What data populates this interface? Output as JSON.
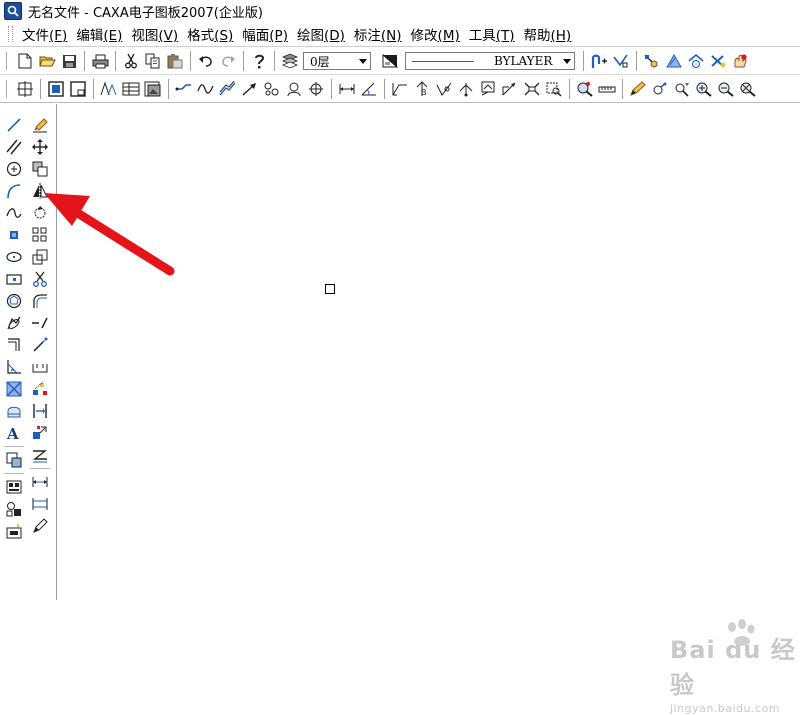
{
  "window": {
    "title": "无名文件 - CAXA电子图板2007(企业版)"
  },
  "menu": [
    {
      "label": "文件",
      "accel": "(F)"
    },
    {
      "label": "编辑",
      "accel": "(E)"
    },
    {
      "label": "视图",
      "accel": "(V)"
    },
    {
      "label": "格式",
      "accel": "(S)"
    },
    {
      "label": "幅面",
      "accel": "(P)"
    },
    {
      "label": "绘图",
      "accel": "(D)"
    },
    {
      "label": "标注",
      "accel": "(N)"
    },
    {
      "label": "修改",
      "accel": "(M)"
    },
    {
      "label": "工具",
      "accel": "(T)"
    },
    {
      "label": "帮助",
      "accel": "(H)"
    }
  ],
  "toolbar": {
    "layer_value": "0层",
    "linetype_value": "BYLAYER"
  },
  "colors": {
    "accent_red": "#e4141a",
    "toolbar_blue": "#1d5fbf",
    "line_red": "#c8272d"
  },
  "watermark": {
    "brand": "Bai du 经验",
    "site": "jingyan.baidu.com"
  }
}
